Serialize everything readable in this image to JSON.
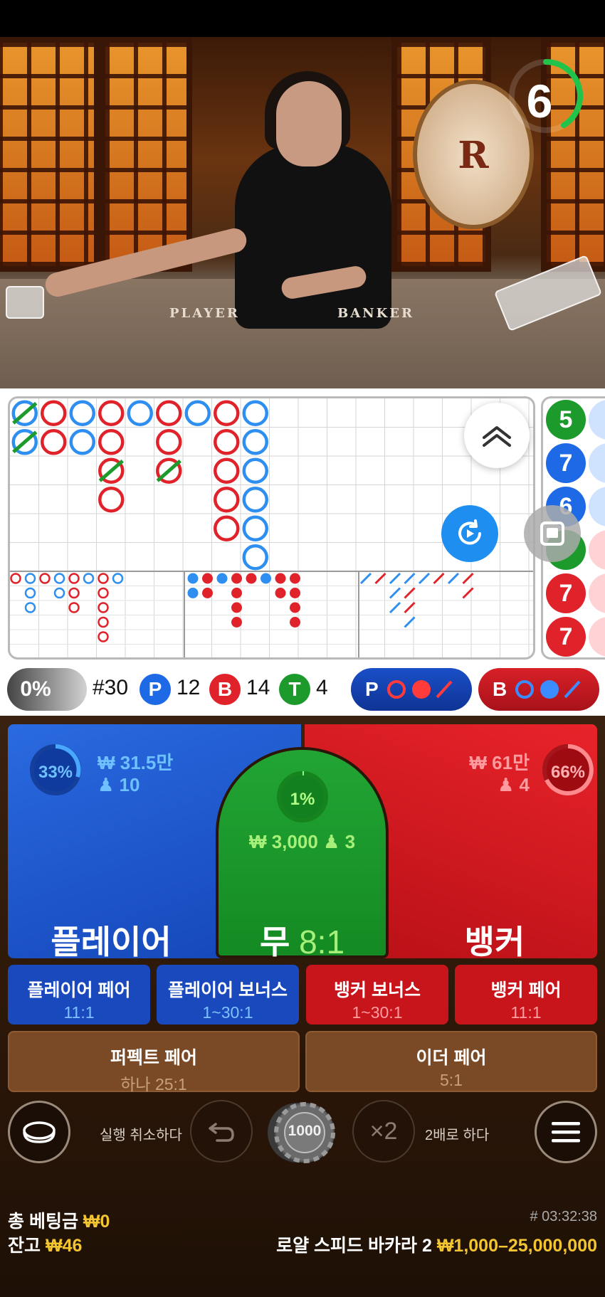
{
  "video": {
    "timer": "6",
    "felt_player": "PLAYER",
    "felt_banker": "BANKER",
    "logo_letter": "R"
  },
  "stats": {
    "percent": "0%",
    "round": "#30",
    "player_letter": "P",
    "player_count": "12",
    "banker_letter": "B",
    "banker_count": "14",
    "tie_letter": "T",
    "tie_count": "4",
    "player_predict_letter": "P",
    "banker_predict_letter": "B"
  },
  "bead_road": [
    "5",
    "7",
    "6",
    "",
    "7",
    "7"
  ],
  "bets": {
    "player": {
      "label": "플레이어",
      "percent": "33%",
      "amount": "₩ 31.5만",
      "players": "10"
    },
    "tie": {
      "label": "무",
      "odds": "8:1",
      "percent": "1%",
      "amount": "₩ 3,000",
      "players": "3"
    },
    "banker": {
      "label": "뱅커",
      "percent": "66%",
      "amount": "₩ 61만",
      "players": "4"
    },
    "side": [
      {
        "label": "플레이어 페어",
        "odds": "11:1"
      },
      {
        "label": "플레이어 보너스",
        "odds": "1~30:1"
      },
      {
        "label": "뱅커 보너스",
        "odds": "1~30:1"
      },
      {
        "label": "뱅커 페어",
        "odds": "11:1"
      }
    ],
    "extra": [
      {
        "label": "퍼펙트 페어",
        "odds": "하나 25:1"
      },
      {
        "label": "이더 페어",
        "odds": "5:1"
      }
    ]
  },
  "controls": {
    "undo_label": "실행 취소하다",
    "chip_value": "1000",
    "double_symbol": "×2",
    "double_label": "2배로 하다"
  },
  "footer": {
    "total_bet_label": "총 베팅금",
    "total_bet_value": "₩0",
    "balance_label": "잔고",
    "balance_value": "₩46",
    "game_id": "# 03:32:38",
    "table_name": "로얄 스피드 바카라 2",
    "limits": "₩1,000–25,000,000"
  },
  "colors": {
    "player_blue": "#1e6ae6",
    "banker_red": "#e0232a",
    "tie_green": "#1c9a2c",
    "road_blue": "#2e8ff0",
    "road_red": "#e0232a"
  }
}
